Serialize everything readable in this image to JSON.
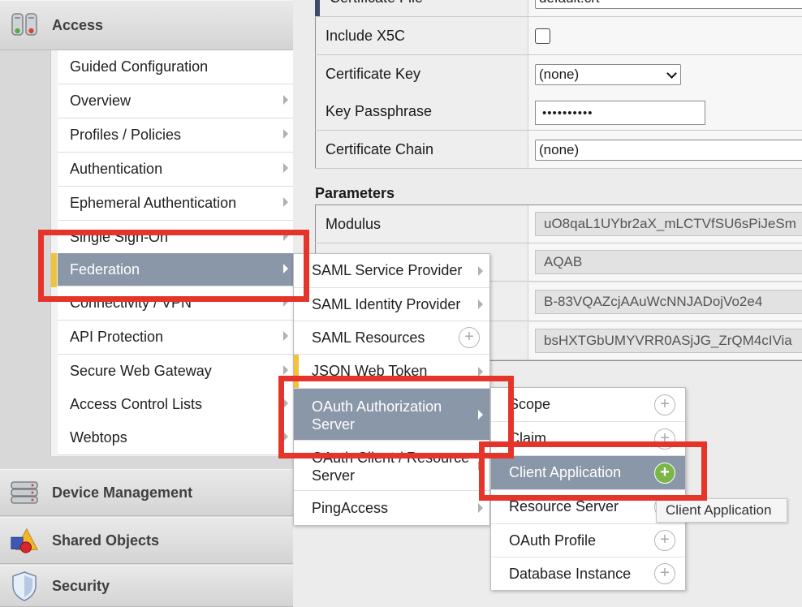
{
  "nav": {
    "access_label": "Access",
    "access_items": [
      {
        "label": "Guided Configuration",
        "arrow": false
      },
      {
        "label": "Overview",
        "arrow": true
      },
      {
        "label": "Profiles / Policies",
        "arrow": true
      },
      {
        "label": "Authentication",
        "arrow": true
      },
      {
        "label": "Ephemeral Authentication",
        "arrow": true
      },
      {
        "label": "Single Sign-On",
        "arrow": true
      },
      {
        "label": "Federation",
        "arrow": true,
        "active": true
      },
      {
        "label": "Connectivity / VPN",
        "arrow": true
      },
      {
        "label": "API Protection",
        "arrow": true
      },
      {
        "label": "Secure Web Gateway",
        "arrow": true
      },
      {
        "label": "Access Control Lists",
        "arrow": true
      },
      {
        "label": "Webtops",
        "arrow": true
      }
    ],
    "device_management_label": "Device Management",
    "shared_objects_label": "Shared Objects",
    "security_label": "Security"
  },
  "form": {
    "certificate_file_label": "Certificate File",
    "certificate_file_value": "default.crt",
    "include_x5c_label": "Include X5C",
    "include_x5c_checked": false,
    "certificate_key_label": "Certificate Key",
    "certificate_key_value": "(none)",
    "key_passphrase_label": "Key Passphrase",
    "key_passphrase_value": "••••••••••",
    "certificate_chain_label": "Certificate Chain",
    "certificate_chain_value": "(none)",
    "parameters_heading": "Parameters",
    "modulus_label": "Modulus",
    "modulus_value": "uO8qaL1UYbr2aX_mLCTVfSU6sPiJeSm",
    "param_values": [
      "AQAB",
      "B-83VQAZcjAAuWcNNJADojVo2e4",
      "bsHXTGbUMYVRR0ASjJG_ZrQM4cIVia"
    ]
  },
  "federation_menu": [
    {
      "label": "SAML Service Provider",
      "type": "arrow"
    },
    {
      "label": "SAML Identity Provider",
      "type": "arrow"
    },
    {
      "label": "SAML Resources",
      "type": "plus"
    },
    {
      "label": "JSON Web Token",
      "type": "arrow"
    },
    {
      "label": "OAuth Authorization Server",
      "type": "arrow",
      "active": true
    },
    {
      "label": "OAuth Client / Resource Server",
      "type": "arrow"
    },
    {
      "label": "PingAccess",
      "type": "arrow"
    }
  ],
  "oauth_menu": [
    {
      "label": "Scope"
    },
    {
      "label": "Claim"
    },
    {
      "label": "Client Application",
      "active": true
    },
    {
      "label": "Resource Server"
    },
    {
      "label": "OAuth Profile"
    },
    {
      "label": "Database Instance"
    }
  ],
  "tooltip": "Client Application",
  "colors": {
    "highlight": "#e5352a",
    "active_item": "#8a97a9",
    "yellow_marker": "#f1c338",
    "green_plus": "#7ab648"
  }
}
